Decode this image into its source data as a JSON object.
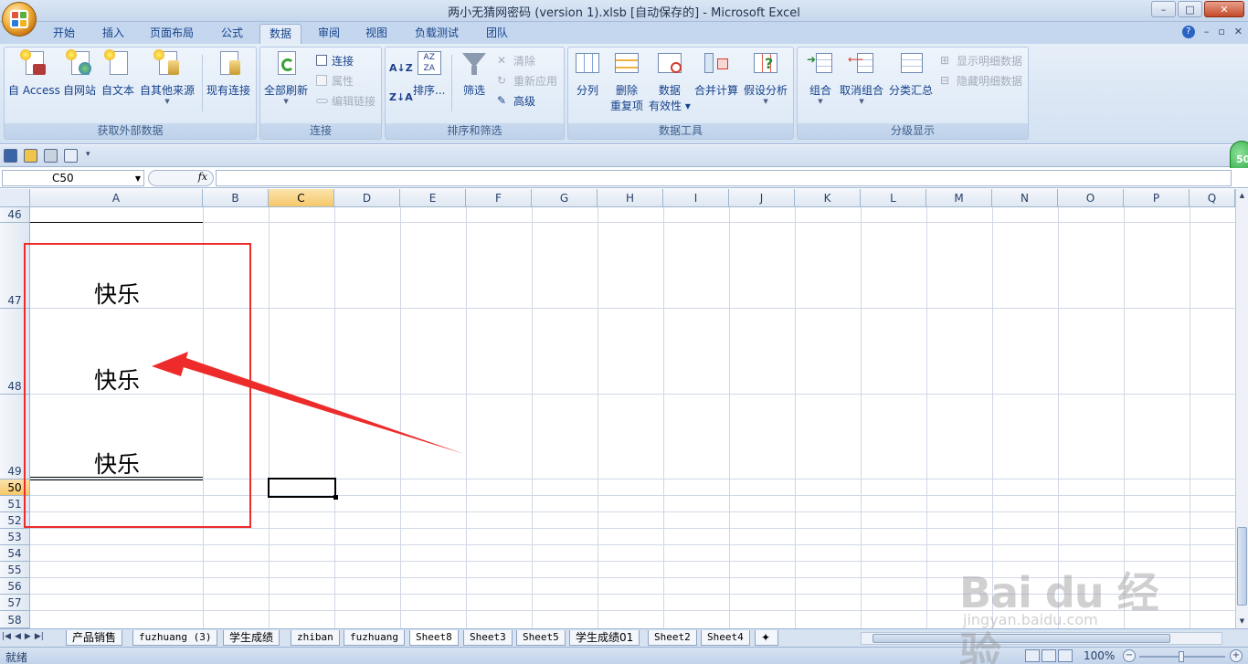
{
  "window": {
    "title": "两小无猜网密码 (version 1).xlsb [自动保存的] - Microsoft Excel",
    "controls": [
      "–",
      "□",
      "✕"
    ]
  },
  "ribbon_tabs": [
    "开始",
    "插入",
    "页面布局",
    "公式",
    "数据",
    "审阅",
    "视图",
    "负载测试",
    "团队"
  ],
  "ribbon_right": {
    "help": "?",
    "min": "–",
    "restore": "▫",
    "close": "✕"
  },
  "ribbon": {
    "groups": {
      "external": {
        "label": "获取外部数据",
        "access": "自 Access",
        "web": "自网站",
        "text": "自文本",
        "other": "自其他来源",
        "existing": "现有连接"
      },
      "connections": {
        "label": "连接",
        "refresh_all": "全部刷新",
        "connections": "连接",
        "properties": "属性",
        "edit_links": "编辑链接"
      },
      "sort_filter": {
        "label": "排序和筛选",
        "sort": "排序...",
        "filter": "筛选",
        "clear": "清除",
        "reapply": "重新应用",
        "advanced": "高级"
      },
      "data_tools": {
        "label": "数据工具",
        "text_to_columns": "分列",
        "remove_dup_1": "删除",
        "remove_dup_2": "重复项",
        "validation_1": "数据",
        "validation_2": "有效性",
        "consolidate": "合并计算",
        "whatif": "假设分析"
      },
      "outline": {
        "label": "分级显示",
        "group": "组合",
        "ungroup": "取消组合",
        "subtotal": "分类汇总",
        "show_detail": "显示明细数据",
        "hide_detail": "隐藏明细数据"
      }
    }
  },
  "formula_bar": {
    "name_box": "C50",
    "fx": "fx",
    "formula": ""
  },
  "grid": {
    "columns": [
      "A",
      "B",
      "C",
      "D",
      "E",
      "F",
      "G",
      "H",
      "I",
      "J",
      "K",
      "L",
      "M",
      "N",
      "O",
      "P",
      "Q"
    ],
    "selected_column": "C",
    "rows": [
      "46",
      "47",
      "48",
      "49",
      "50",
      "51",
      "52",
      "53",
      "54",
      "55",
      "56",
      "57",
      "58"
    ],
    "selected_row": "50",
    "cells": [
      {
        "ref": "A47",
        "value": "快乐"
      },
      {
        "ref": "A48",
        "value": "快乐"
      },
      {
        "ref": "A49",
        "value": "快乐"
      }
    ],
    "active_cell": "C50"
  },
  "annotation": {
    "color": "#ee2b2b",
    "shape": "rectangle-and-arrow"
  },
  "sheet_tabs": [
    "产品销售",
    "fuzhuang (3)",
    "学生成绩",
    "zhiban",
    "fuzhuang",
    "Sheet8",
    "Sheet3",
    "Sheet5",
    "学生成绩01",
    "Sheet2",
    "Sheet4"
  ],
  "active_sheet": "Sheet8",
  "status": {
    "text": "就绪",
    "zoom": "100%"
  },
  "badge": "50",
  "watermark": {
    "brand": "Bai du 经验",
    "url": "jingyan.baidu.com"
  }
}
